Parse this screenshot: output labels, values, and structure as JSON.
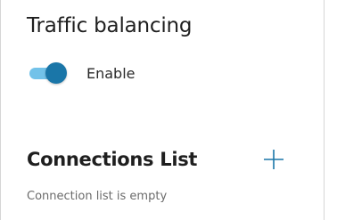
{
  "panel": {
    "title": "Traffic balancing",
    "toggle": {
      "label": "Enable",
      "checked": true,
      "track_color": "#72c2e9",
      "thumb_color": "#1a76a8"
    },
    "connections": {
      "title": "Connections List",
      "add_icon": "plus-icon",
      "add_icon_color": "#1a76a8",
      "empty_message": "Connection list is empty"
    }
  }
}
